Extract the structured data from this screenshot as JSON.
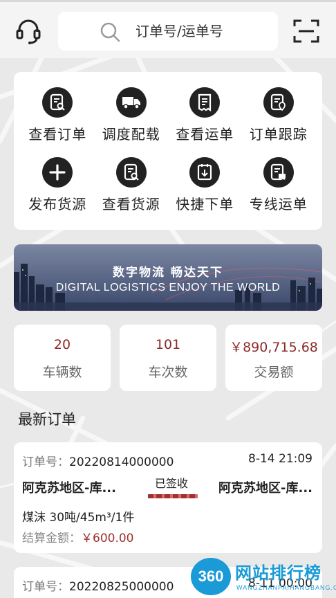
{
  "header": {
    "search_placeholder": "订单号/运单号",
    "support_icon": "headset-icon",
    "scan_icon": "scan-icon"
  },
  "menu": [
    {
      "label": "查看订单",
      "icon": "view-order-icon"
    },
    {
      "label": "调度配载",
      "icon": "truck-icon"
    },
    {
      "label": "查看运单",
      "icon": "waybill-icon"
    },
    {
      "label": "订单跟踪",
      "icon": "track-icon"
    },
    {
      "label": "发布货源",
      "icon": "plus-icon"
    },
    {
      "label": "查看货源",
      "icon": "search-doc-icon"
    },
    {
      "label": "快捷下单",
      "icon": "quick-order-icon"
    },
    {
      "label": "专线运单",
      "icon": "line-waybill-icon"
    }
  ],
  "banner": {
    "title": "数字物流  畅达天下",
    "subtitle": "DIGITAL LOGISTICS  ENJOY THE WORLD"
  },
  "stats": [
    {
      "value": "20",
      "label": "车辆数"
    },
    {
      "value": "101",
      "label": "车次数"
    },
    {
      "value": "￥890,715.68",
      "label": "交易额"
    }
  ],
  "section_title": "最新订单",
  "orders": [
    {
      "no_label": "订单号：",
      "no": "20220814000000",
      "time": "8-14 21:09",
      "from": "阿克苏地区-库...",
      "to": "阿克苏地区-库...",
      "status": "已签收",
      "goods": "煤沫 30吨/45m³/1件",
      "amount_label": "结算金额：",
      "amount": "￥600.00"
    },
    {
      "no_label": "订单号：",
      "no": "20220825000000",
      "time": "8-11 00:00"
    }
  ],
  "watermark": {
    "badge": "360",
    "text": "网站排行榜",
    "sub": "WANGZHANPAIHANGBANG.CN"
  },
  "colors": {
    "accent": "#8b2a2a",
    "price": "#a03030",
    "icon_bg": "#222222"
  }
}
